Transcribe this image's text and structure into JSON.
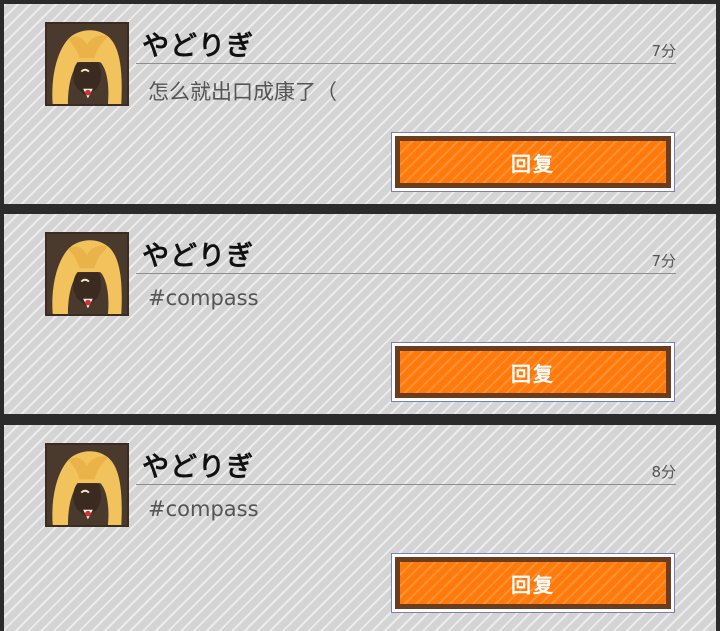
{
  "notifications": [
    {
      "user": "やどりぎ",
      "time": "7分",
      "message": "怎么就出口成康了（",
      "reply_label": "回复"
    },
    {
      "user": "やどりぎ",
      "time": "7分",
      "message": "#compass",
      "reply_label": "回复"
    },
    {
      "user": "やどりぎ",
      "time": "8分",
      "message": "#compass",
      "reply_label": "回复"
    }
  ],
  "colors": {
    "card_bg": "#d4d4d4",
    "button_orange": "#ff7a0a",
    "button_border": "#6b3c1e",
    "avatar_bg": "#4a3a2d",
    "avatar_hair": "#f2c35c"
  },
  "icons": {
    "avatar": "anime-girl-avatar"
  }
}
